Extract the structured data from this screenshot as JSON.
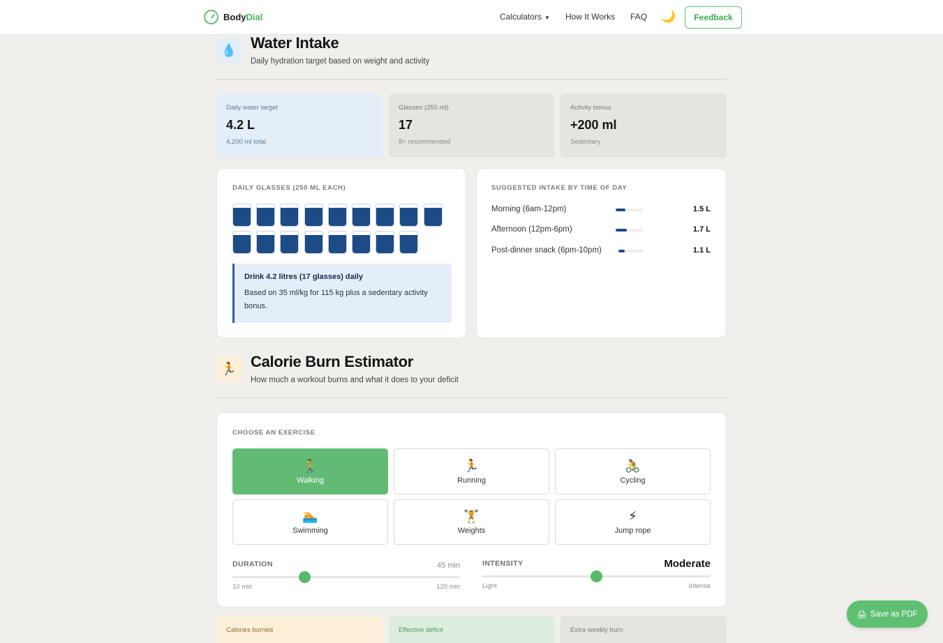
{
  "header": {
    "logo_part1": "Body",
    "logo_part2": "Dial",
    "nav": [
      "Calculators",
      "How It Works",
      "FAQ"
    ],
    "dropdown_caret": "▼",
    "theme_icon": "🌙",
    "feedback_label": "Feedback"
  },
  "water": {
    "icon": "💧",
    "title": "Water Intake",
    "subtitle": "Daily hydration target based on weight and activity",
    "stats": [
      {
        "label": "Daily water target",
        "value": "4.2 L",
        "note": "4,200 ml total"
      },
      {
        "label": "Glasses (250 ml)",
        "value": "17",
        "note": "8+ recommended"
      },
      {
        "label": "Activity bonus",
        "value": "+200 ml",
        "note": "Sedentary"
      }
    ],
    "glasses_caption": "Daily glasses (250 ml each)",
    "glasses_count": 17,
    "tip_title": "Drink 4.2 litres (17 glasses) daily",
    "tip_body": "Based on 35 ml/kg for 115 kg plus a sedentary activity bonus.",
    "schedule_caption": "Suggested intake by time of day",
    "schedule": [
      {
        "name": "Morning (6am-12pm)",
        "value": "1.5 L",
        "liters": 1.5
      },
      {
        "name": "Afternoon (12pm-6pm)",
        "value": "1.7 L",
        "liters": 1.7
      },
      {
        "name": "Post-dinner snack (6pm-10pm)",
        "value": "1.1 L",
        "liters": 1.1
      }
    ]
  },
  "calorie": {
    "icon": "🏃",
    "title": "Calorie Burn Estimator",
    "subtitle": "How much a workout burns and what it does to your deficit",
    "exercise_caption": "Choose an exercise",
    "exercises": [
      {
        "icon": "🚶",
        "label": "Walking",
        "active": true
      },
      {
        "icon": "🏃",
        "label": "Running",
        "active": false
      },
      {
        "icon": "🚴",
        "label": "Cycling",
        "active": false
      },
      {
        "icon": "🏊",
        "label": "Swimming",
        "active": false
      },
      {
        "icon": "🏋️",
        "label": "Weights",
        "active": false
      },
      {
        "icon": "⚡",
        "label": "Jump rope",
        "active": false
      }
    ],
    "duration": {
      "label": "DURATION",
      "value_text": "45 min",
      "min_label": "10 min",
      "max_label": "120 min",
      "min": 10,
      "max": 120,
      "value": 45
    },
    "intensity": {
      "label": "INTENSITY",
      "value_text": "Moderate",
      "min_label": "Light",
      "max_label": "Intense",
      "level": 0.5
    },
    "result_labels": [
      "Calories burned",
      "Effective deficit",
      "Extra weekly burn"
    ]
  },
  "pdf_button": {
    "icon": "🖨",
    "label": "Save as PDF"
  },
  "colors": {
    "accent": "#5fbf73",
    "water_fill": "#1c4b86"
  }
}
